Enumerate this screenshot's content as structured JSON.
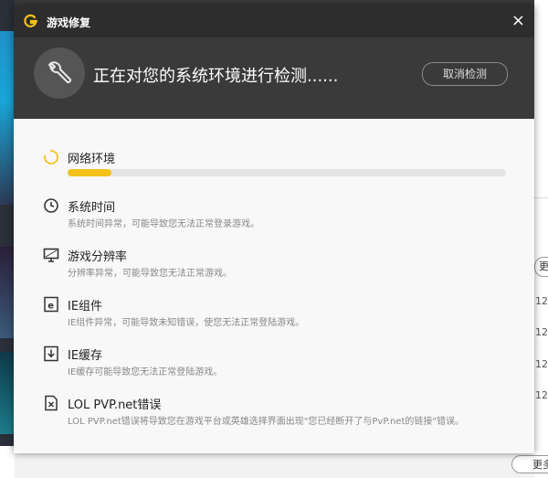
{
  "background": {
    "more_label_1": "更多",
    "more_label_2": "更多",
    "dates": [
      "12-",
      "12-",
      "12-",
      "12-"
    ]
  },
  "dialog": {
    "title": "游戏修复",
    "close_label": "×",
    "status_text": "正在对您的系统环境进行检测......",
    "cancel_label": "取消检测",
    "progress_fraction": 0.1,
    "accent_color": "#f2c21b",
    "items": [
      {
        "icon": "loading-spinner-icon",
        "name": "网络环境",
        "desc": ""
      },
      {
        "icon": "clock-icon",
        "name": "系统时间",
        "desc": "系统时间异常，可能导致您无法正常登录游戏。"
      },
      {
        "icon": "monitor-icon",
        "name": "游戏分辨率",
        "desc": "分辨率异常，可能导致您无法正常游戏。"
      },
      {
        "icon": "ie-component-icon",
        "name": "IE组件",
        "desc": "IE组件异常，可能导致未知错误，使您无法正常登陆游戏。"
      },
      {
        "icon": "download-cache-icon",
        "name": "IE缓存",
        "desc": "IE缓存可能导致您无法正常登陆游戏。"
      },
      {
        "icon": "error-file-icon",
        "name": "LOL PVP.net错误",
        "desc": "LOL PVP.net错误将导致您在游戏平台或英雄选择界面出现\"您已经断开了与PvP.net的链接\"错误。"
      }
    ]
  }
}
